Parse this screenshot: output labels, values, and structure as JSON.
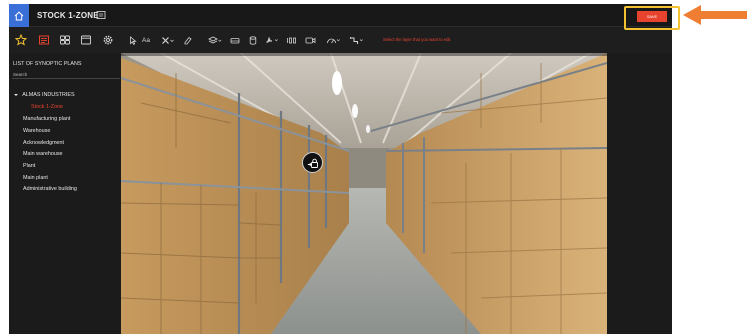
{
  "app": {
    "title": "STOCK 1-ZONE",
    "save_label": "SAVE",
    "hint": "Select the layer that you want to edit"
  },
  "toolbar": {
    "left_icons": [
      "star-icon",
      "layers-folder-icon",
      "grid-icon",
      "window-icon",
      "gear-icon"
    ],
    "tools": [
      "pointer-icon",
      "text-icon",
      "close-icon",
      "eraser-icon",
      "layers-icon",
      "vehicle-icon",
      "cylinder-icon",
      "fan-icon",
      "pressure-icon",
      "camera-icon",
      "gauge-icon",
      "pipe-icon"
    ],
    "text_tool_label": "Aa"
  },
  "sidebar": {
    "title": "LIST OF SYNOPTIC PLANS",
    "search_placeholder": "Search",
    "root": "ALMAS INDUSTRIES",
    "active_item": "Stock 1-Zone",
    "items": [
      "Manufacturing plant",
      "Warehouse",
      "Acknowledgment",
      "Main warehouse",
      "Plant",
      "Main plant",
      "Administrative building"
    ]
  },
  "colors": {
    "accent": "#e8432f",
    "home": "#3b6fd8",
    "callout_box": "#f2c230",
    "callout_arrow": "#ef7d32",
    "star": "#f2c230"
  }
}
